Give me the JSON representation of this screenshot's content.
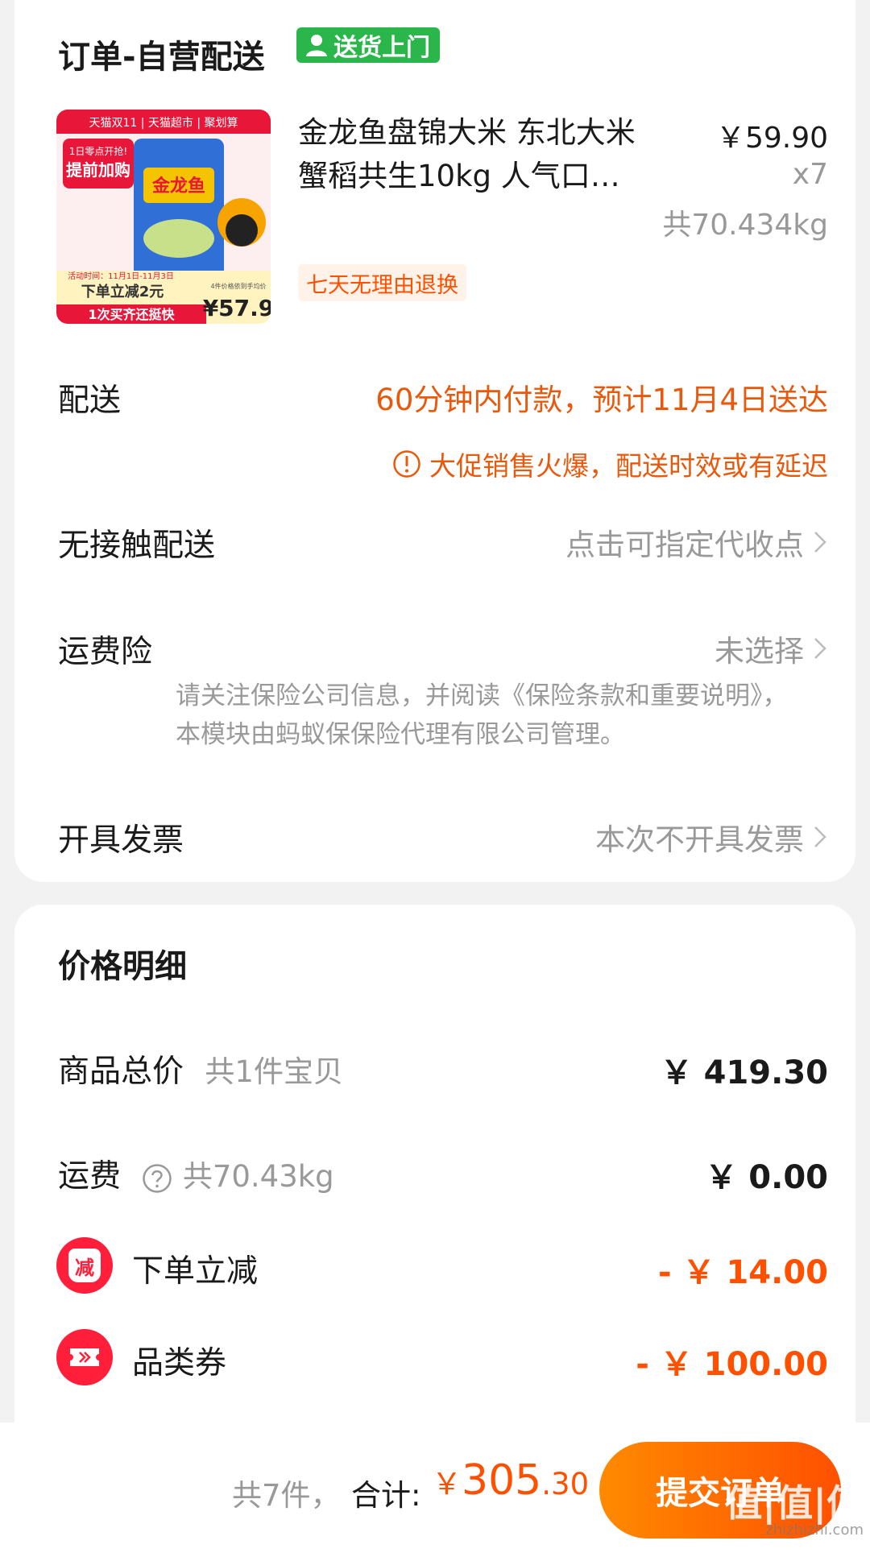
{
  "order": {
    "title": "订单-自营配送",
    "badge": "送货上门",
    "product": {
      "image_banner": "天猫双11 | 天猫超市 | 聚划算",
      "image_promo": "提前加购",
      "image_promo_small": "1日零点开抢!",
      "image_brand": "金龙鱼",
      "image_event": "活动时间：11月1日-11月3日",
      "image_discount": "下单立减2元",
      "image_slogan": "1次买齐还挺快",
      "image_avg_label": "4件价格依到手均价",
      "image_price": "¥57.9",
      "name": "金龙鱼盘锦大米 东北大米蟹稻共生10kg 人气口碑 新老包装随机发货",
      "price": "￥59.90",
      "qty": "x7",
      "weight": "共70.434kg",
      "tag": "七天无理由退换"
    },
    "delivery": {
      "label": "配送",
      "value": "60分钟内付款，预计11月4日送达",
      "warning": "大促销售火爆，配送时效或有延迟"
    },
    "contactless": {
      "label": "无接触配送",
      "value": "点击可指定代收点"
    },
    "insurance": {
      "label": "运费险",
      "value": "未选择",
      "note": "请关注保险公司信息，并阅读《保险条款和重要说明》，本模块由蚂蚁保保险代理有限公司管理。"
    },
    "invoice": {
      "label": "开具发票",
      "value": "本次不开具发票"
    }
  },
  "price_detail": {
    "title": "价格明细",
    "goods_total": {
      "label": "商品总价",
      "sub": "共1件宝贝",
      "value": "￥ 419.30"
    },
    "shipping": {
      "label": "运费",
      "sub": "共70.43kg",
      "value": "￥ 0.00"
    },
    "instant_discount": {
      "label": "下单立减",
      "icon_text": "减",
      "value": "- ￥ 14.00"
    },
    "category_coupon": {
      "label": "品类券",
      "value": "- ￥ 100.00"
    }
  },
  "bottom_bar": {
    "count": "共7件，",
    "total_label": "合计:",
    "currency": "￥",
    "amount_int": "305",
    "amount_dec": ".30",
    "submit": "提交订单",
    "watermark": "值|值|值",
    "watermark_url": "zhizhizhi.com"
  },
  "colors": {
    "accent": "#ff5000",
    "delivery_orange": "#e8590c",
    "badge_green": "#2bb64b",
    "coupon_red": "#ff1f3a"
  }
}
